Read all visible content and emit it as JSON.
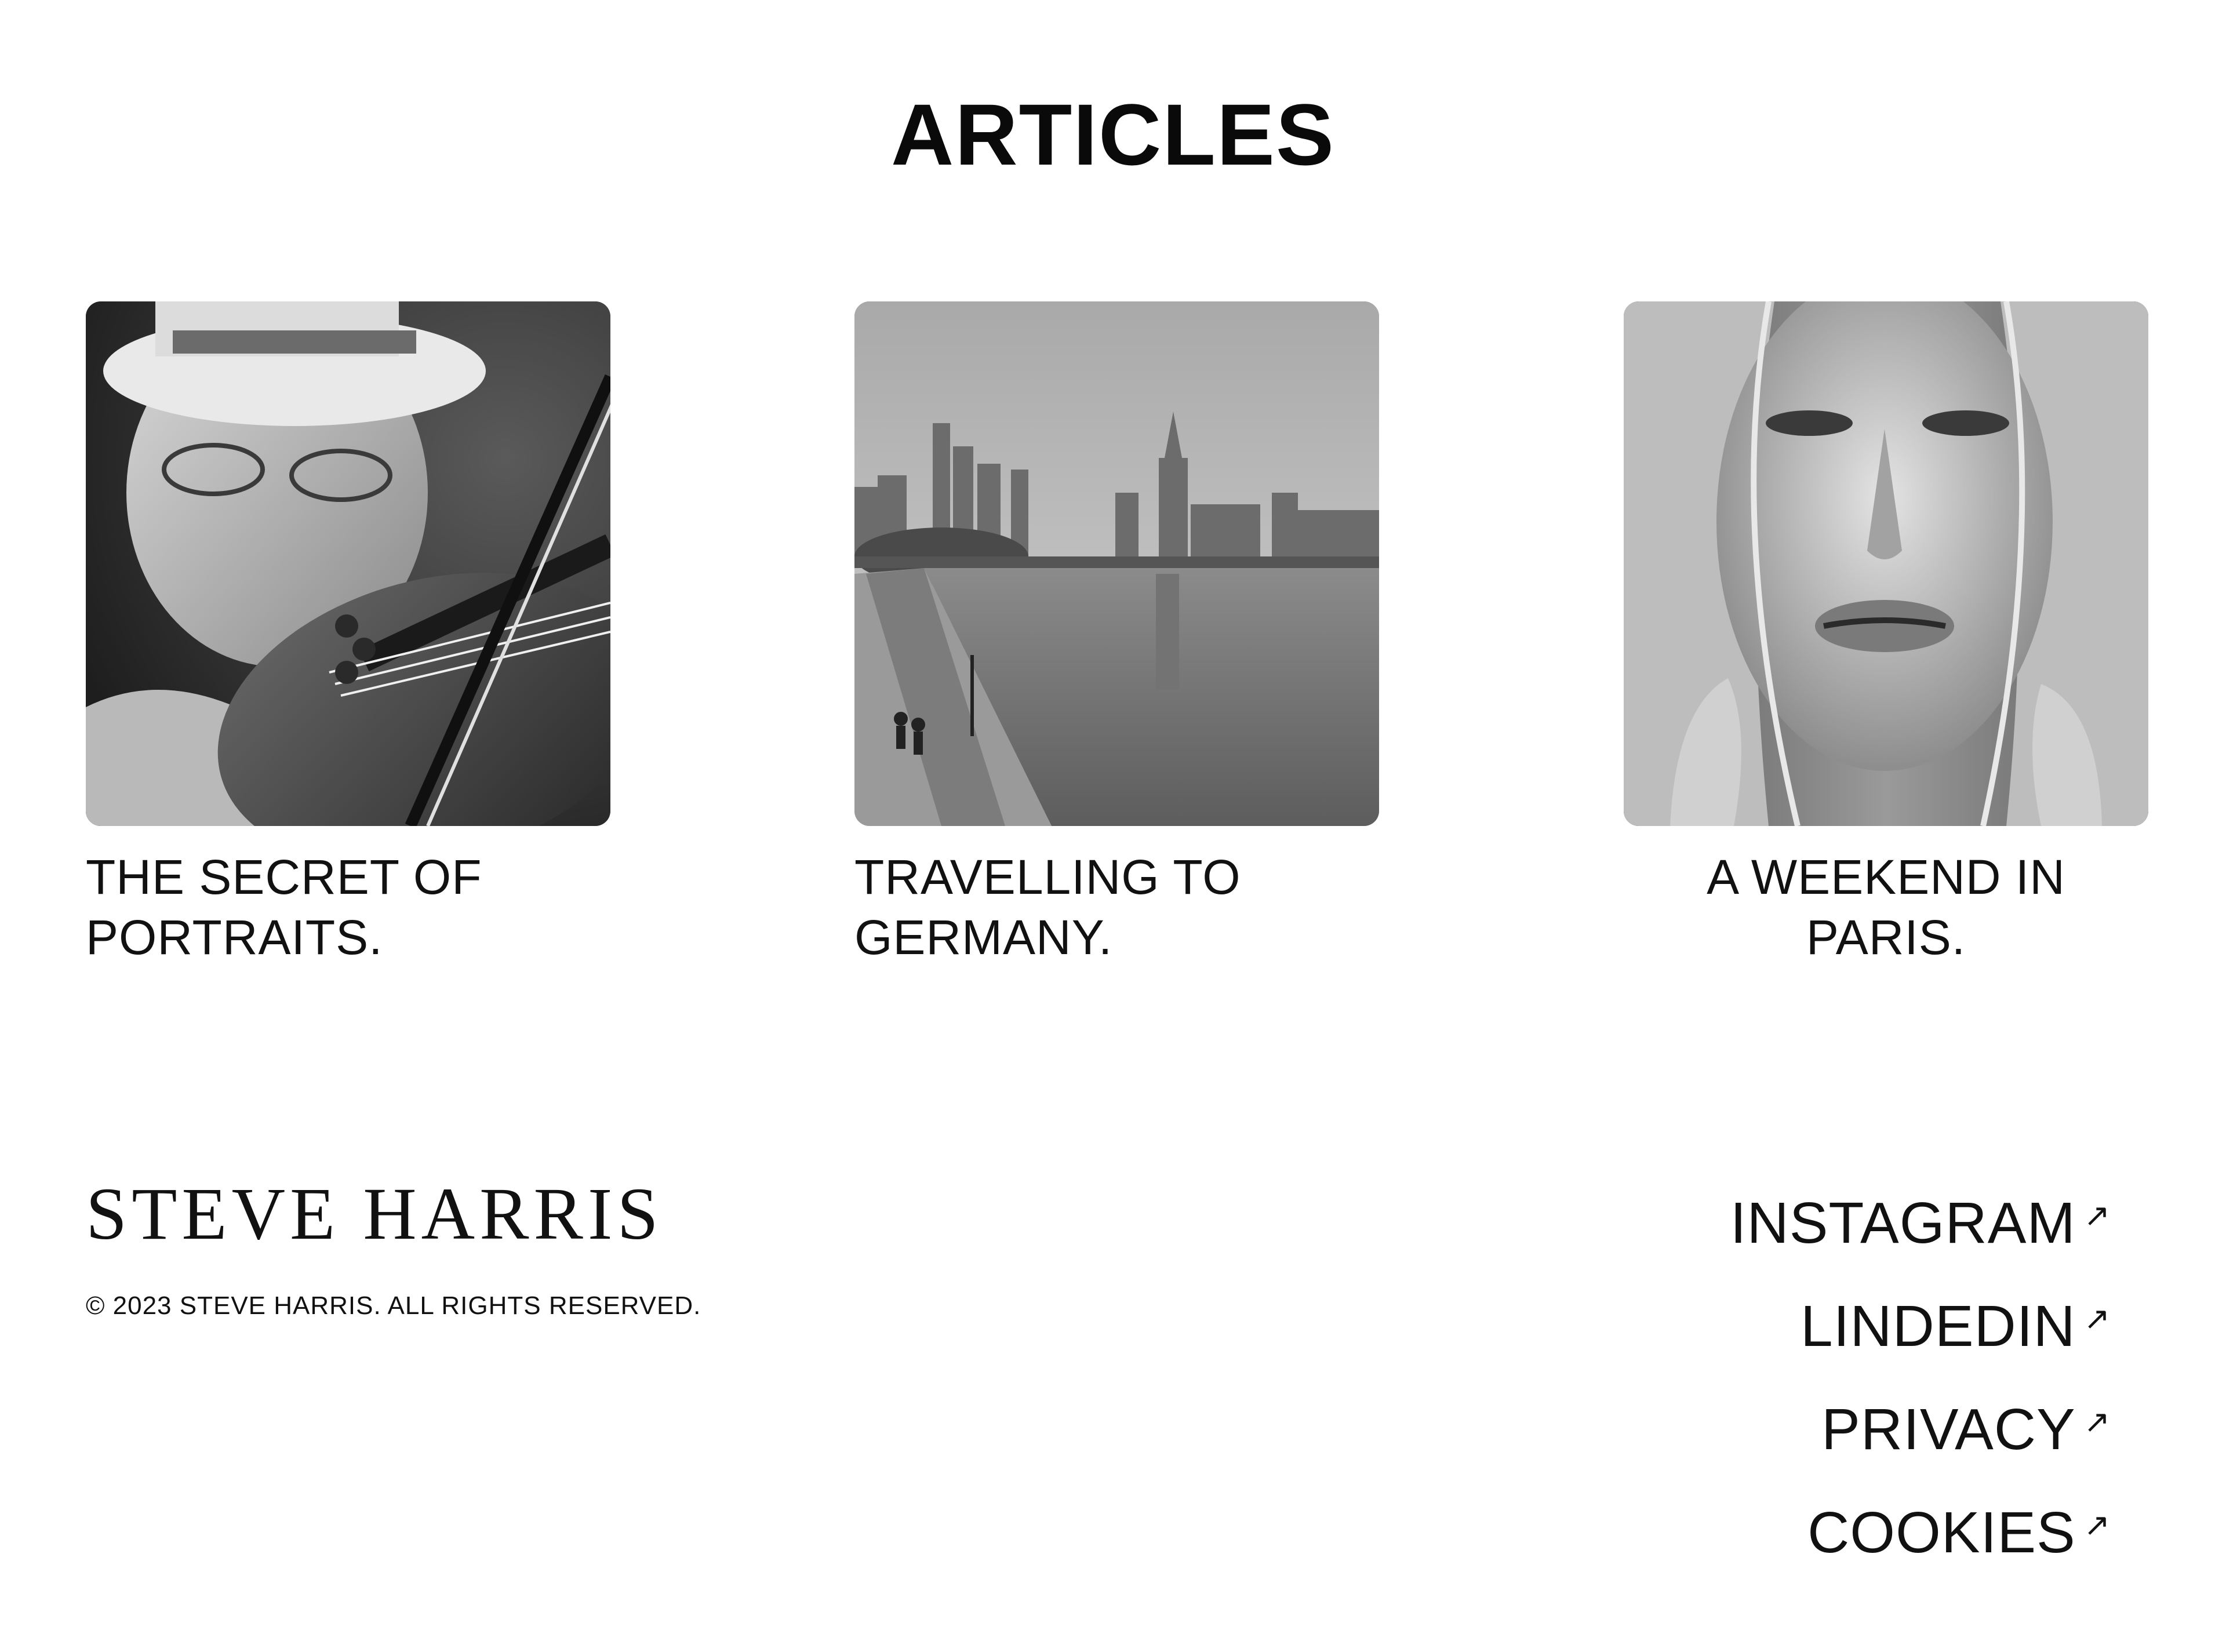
{
  "articles": {
    "heading": "ARTICLES",
    "items": [
      {
        "title": "THE SECRET OF PORTRAITS.",
        "image": "violinist-portrait-photo"
      },
      {
        "title": "TRAVELLING TO GERMANY.",
        "image": "frankfurt-river-skyline-photo"
      },
      {
        "title": "A WEEKEND IN PARIS.",
        "image": "woman-face-portrait-photo"
      }
    ]
  },
  "footer": {
    "brand": "STEVE HARRIS",
    "copyright": "© 2023 STEVE HARRIS. ALL RIGHTS RESERVED.",
    "links": [
      {
        "label": "INSTAGRAM",
        "icon": "external-arrow-icon",
        "arrow": "↗"
      },
      {
        "label": "LINDEDIN",
        "icon": "external-arrow-icon",
        "arrow": "↗"
      },
      {
        "label": "PRIVACY",
        "icon": "external-arrow-icon",
        "arrow": "↗"
      },
      {
        "label": "COOKIES",
        "icon": "external-arrow-icon",
        "arrow": "↗"
      }
    ]
  },
  "colors": {
    "text": "#0a0a0a",
    "background": "#ffffff"
  }
}
